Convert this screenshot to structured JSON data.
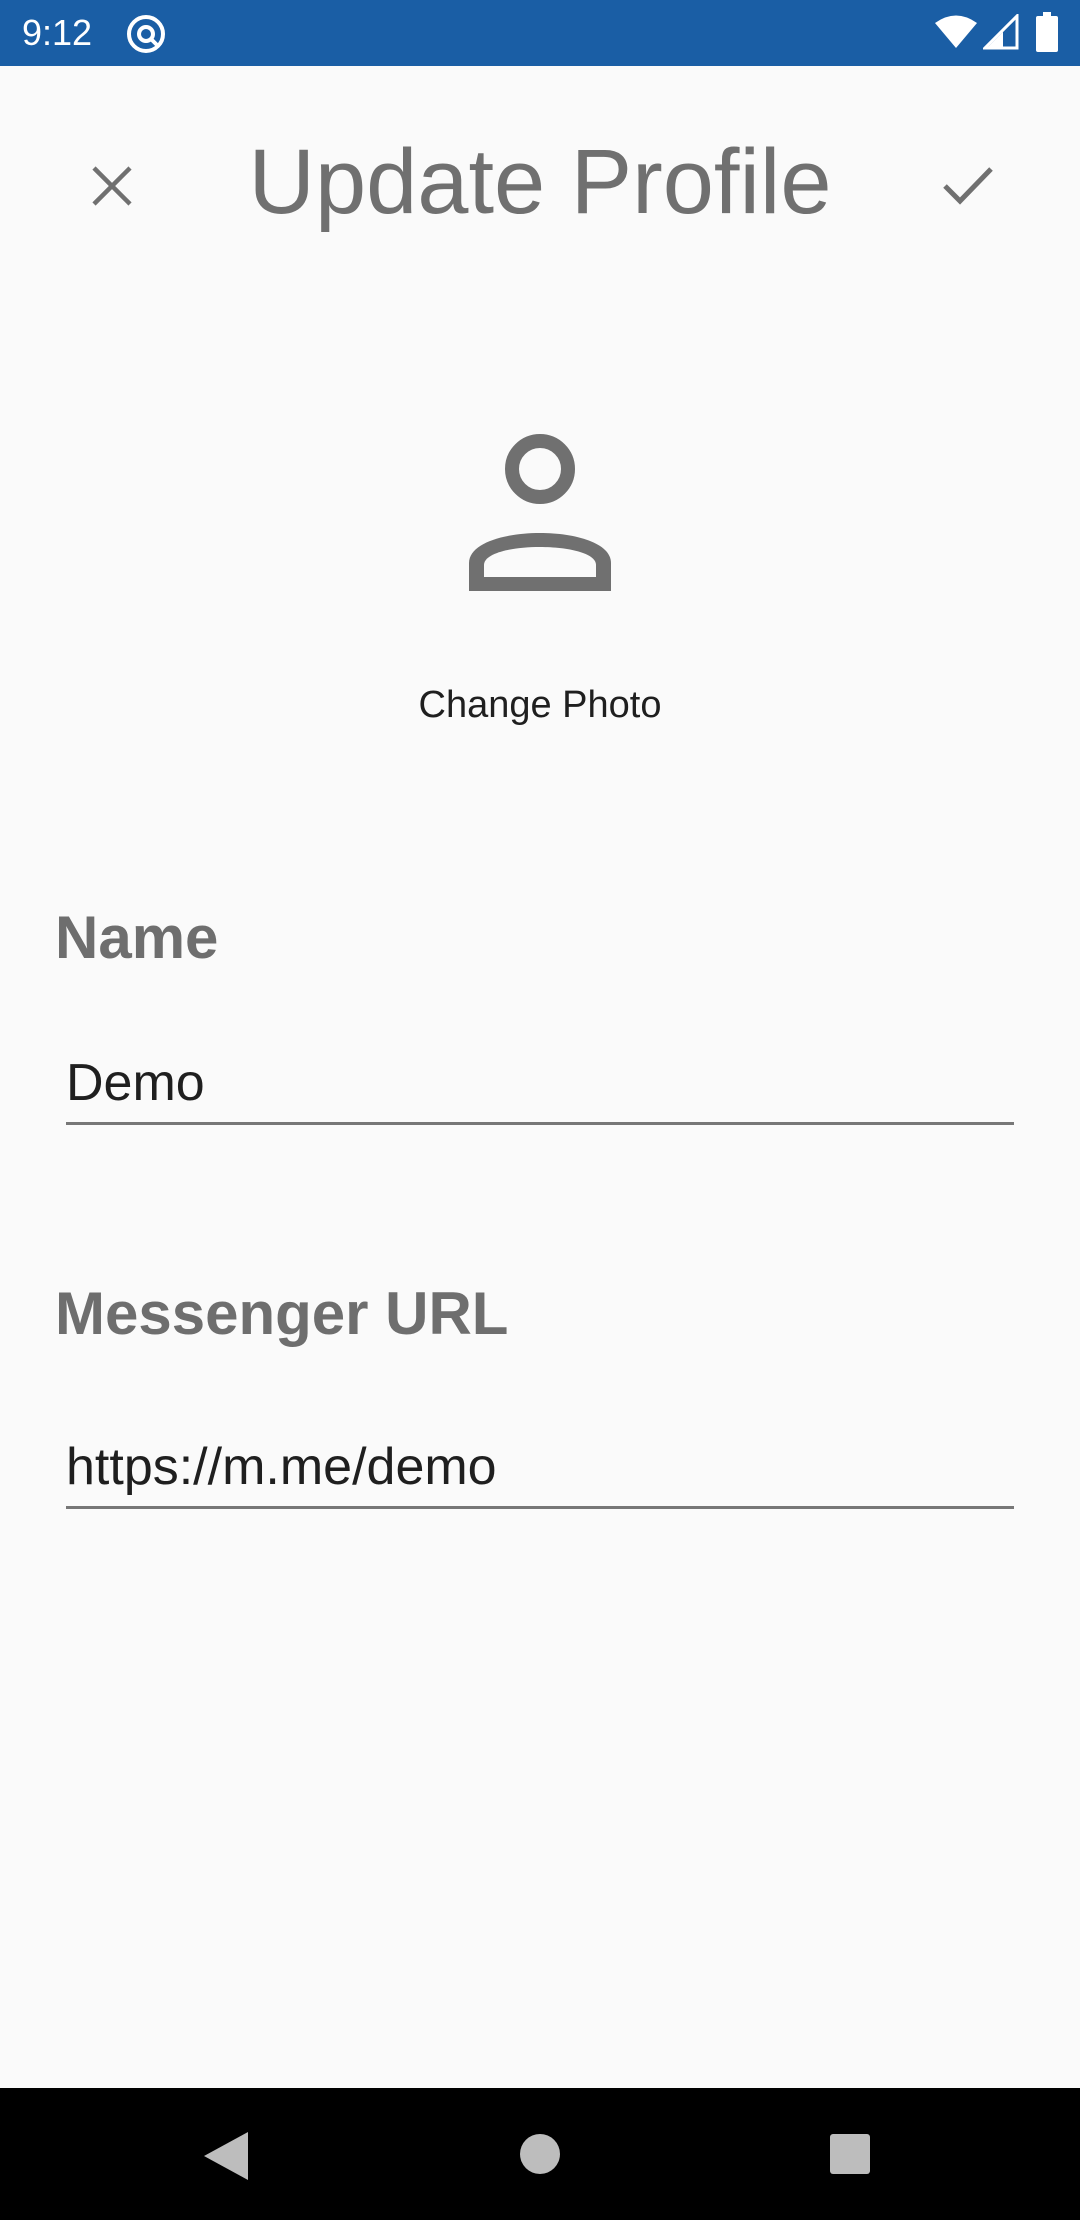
{
  "status_bar": {
    "time": "9:12",
    "app_icon": "at-sign-icon",
    "wifi_icon": "wifi-icon",
    "signal_icon": "cell-signal-icon",
    "battery_icon": "battery-icon",
    "background_color": "#1a5ea5"
  },
  "toolbar": {
    "title": "Update Profile",
    "close_icon": "close-icon",
    "confirm_icon": "checkmark-icon"
  },
  "profile": {
    "avatar_icon": "person-icon",
    "change_photo_label": "Change Photo"
  },
  "form": {
    "name": {
      "label": "Name",
      "value": "Demo"
    },
    "messenger": {
      "label": "Messenger URL",
      "value": "https://m.me/demo"
    }
  },
  "nav_bar": {
    "back_icon": "back-triangle-icon",
    "home_icon": "home-circle-icon",
    "recents_icon": "recents-square-icon"
  }
}
